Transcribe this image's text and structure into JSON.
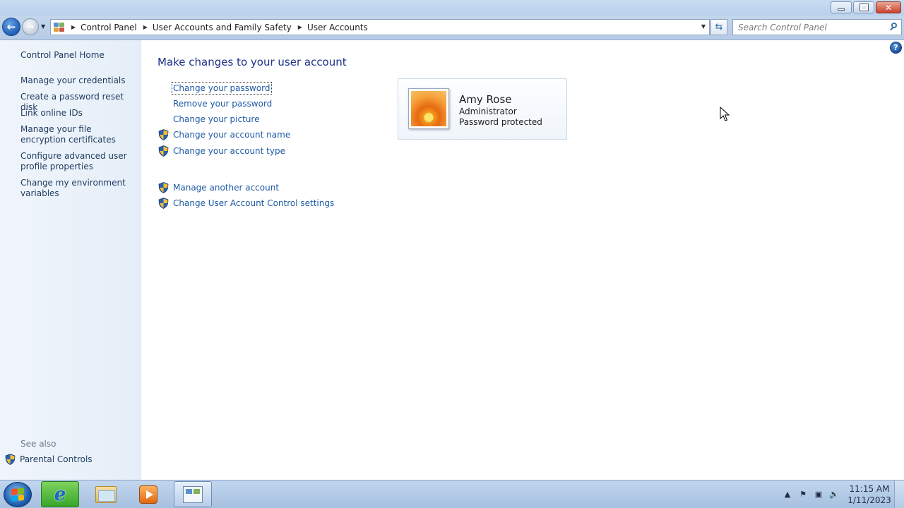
{
  "window": {
    "buttons": {
      "minimize": "minimize",
      "maximize": "restore",
      "close": "close"
    }
  },
  "nav": {
    "breadcrumb": [
      "Control Panel",
      "User Accounts and Family Safety",
      "User Accounts"
    ],
    "search_placeholder": "Search Control Panel"
  },
  "sidebar": {
    "home": "Control Panel Home",
    "links": [
      "Manage your credentials",
      "Create a password reset disk",
      "Link online IDs",
      "Manage your file encryption certificates",
      "Configure advanced user profile properties",
      "Change my environment variables"
    ],
    "see_also_label": "See also",
    "see_also_links": [
      "Parental Controls"
    ]
  },
  "main": {
    "title": "Make changes to your user account",
    "tasks": [
      {
        "label": "Change your password",
        "shield": false
      },
      {
        "label": "Remove your password",
        "shield": false
      },
      {
        "label": "Change your picture",
        "shield": false
      },
      {
        "label": "Change your account name",
        "shield": true
      },
      {
        "label": "Change your account type",
        "shield": true
      }
    ],
    "other_tasks": [
      {
        "label": "Manage another account",
        "shield": true
      },
      {
        "label": "Change User Account Control settings",
        "shield": true
      }
    ],
    "user": {
      "name": "Amy Rose",
      "role": "Administrator",
      "status": "Password protected"
    }
  },
  "taskbar": {
    "clock_time": "11:15 AM",
    "clock_date": "1/11/2023"
  },
  "colors": {
    "link": "#1e5aa5",
    "title": "#1e3287",
    "sidebar_link": "#1e3a5f"
  }
}
